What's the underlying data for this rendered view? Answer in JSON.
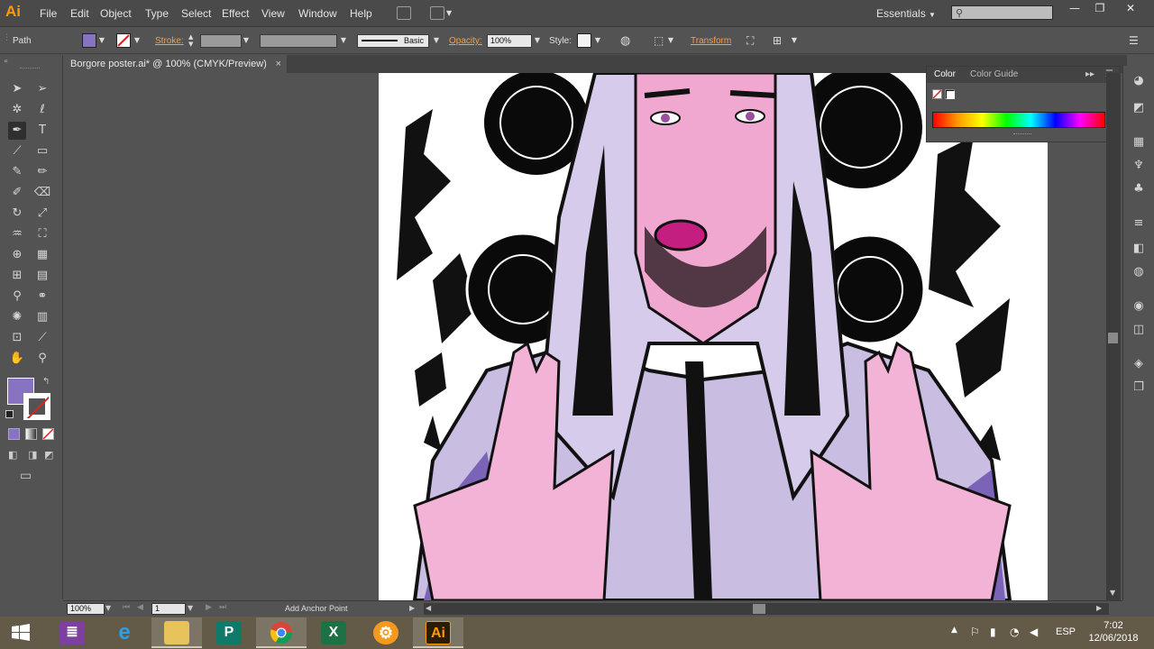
{
  "app": {
    "logo": "Ai",
    "menu": [
      "File",
      "Edit",
      "Object",
      "Type",
      "Select",
      "Effect",
      "View",
      "Window",
      "Help"
    ],
    "workspace": "Essentials",
    "accent": "#ff9a00"
  },
  "control_bar": {
    "selection": "Path",
    "fill_color": "#8873c0",
    "stroke_label": "Stroke:",
    "brush_label": "Basic",
    "opacity_label": "Opacity:",
    "opacity_value": "100%",
    "style_label": "Style:",
    "transform_label": "Transform"
  },
  "document": {
    "tab_title": "Borgore poster.ai* @ 100% (CMYK/Preview)",
    "close": "×"
  },
  "color_panel": {
    "tabs": [
      "Color",
      "Color Guide"
    ]
  },
  "status_bar": {
    "zoom": "100%",
    "artboard": "1",
    "tool_hint": "Add Anchor Point"
  },
  "taskbar": {
    "lang": "ESP",
    "time": "7:02",
    "date": "12/06/2018",
    "apps": [
      {
        "name": "start",
        "icon": "windows-icon"
      },
      {
        "name": "winrar",
        "icon": "archive-icon"
      },
      {
        "name": "internet-explorer",
        "icon": "ie-icon"
      },
      {
        "name": "file-explorer",
        "icon": "folder-icon"
      },
      {
        "name": "publisher",
        "icon": "publisher-icon",
        "label": "P"
      },
      {
        "name": "chrome",
        "icon": "chrome-icon"
      },
      {
        "name": "excel",
        "icon": "excel-icon",
        "label": "X"
      },
      {
        "name": "settings",
        "icon": "gear-icon"
      },
      {
        "name": "illustrator",
        "icon": "ai-icon",
        "label": "Ai"
      }
    ]
  }
}
